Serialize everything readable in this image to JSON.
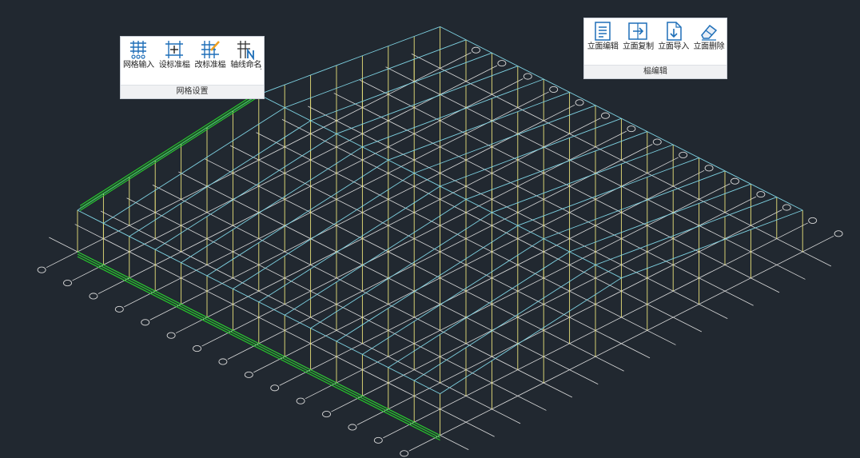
{
  "window": {
    "background": "#212830"
  },
  "colors": {
    "axis_line": "#dcdcdc",
    "column": "#e8e07a",
    "roof": "#7fd3e3",
    "highlight": "#27c92c",
    "bubble": "#d8d8d8",
    "icon_blue": "#1f6fb8"
  },
  "grid_panel": {
    "title": "网格设置",
    "buttons": [
      {
        "label": "网格输入",
        "icon": "grid-dots-icon"
      },
      {
        "label": "设标准榀",
        "icon": "grid-set-icon"
      },
      {
        "label": "改标准榀",
        "icon": "grid-edit-icon"
      },
      {
        "label": "轴线命名",
        "icon": "grid-n-icon"
      }
    ]
  },
  "facade_panel": {
    "title": "榀编辑",
    "buttons": [
      {
        "label": "立面编辑",
        "icon": "document-lines-icon"
      },
      {
        "label": "立面复制",
        "icon": "copy-arrow-icon"
      },
      {
        "label": "立面导入",
        "icon": "import-arrow-icon"
      },
      {
        "label": "立面删除",
        "icon": "eraser-icon"
      }
    ]
  }
}
